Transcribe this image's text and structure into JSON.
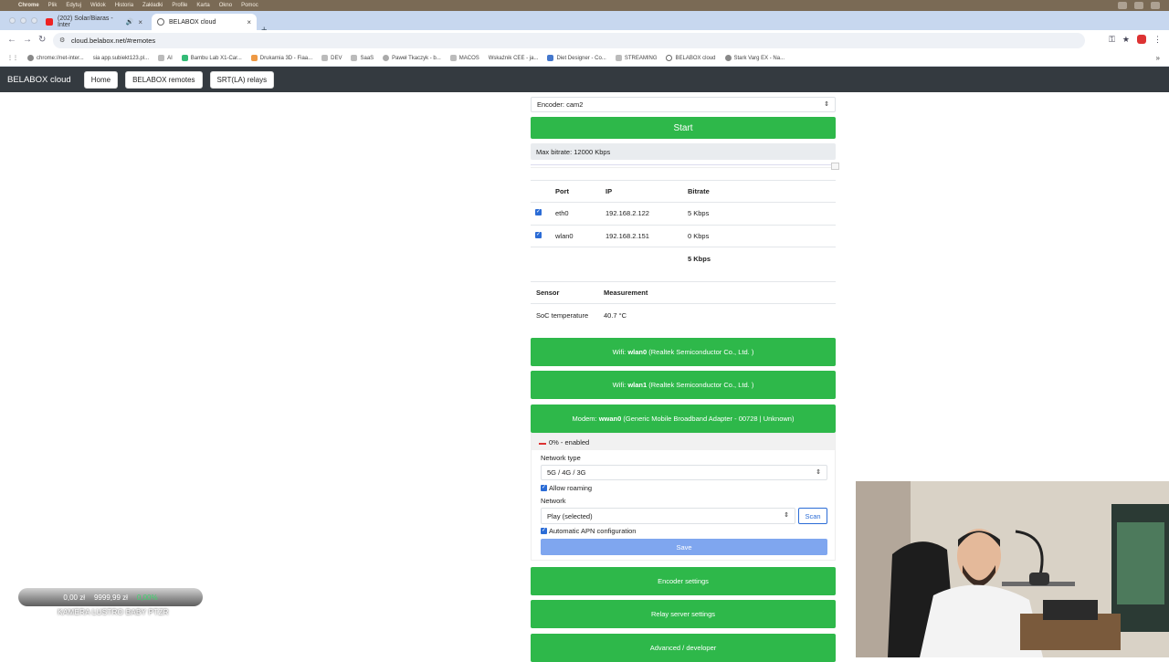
{
  "macos_menubar": {
    "app": "Chrome",
    "items": [
      "Plik",
      "Edytuj",
      "Widok",
      "Historia",
      "Zakładki",
      "Profile",
      "Karta",
      "Okno",
      "Pomoc"
    ]
  },
  "browser": {
    "tabs": [
      {
        "title": "(202) Solar/Biaras - Inter",
        "active": false
      },
      {
        "title": "BELABOX cloud",
        "active": true
      }
    ],
    "url": "cloud.belabox.net/#remotes",
    "bookmarks": [
      "chrome://net-inter...",
      "sia app.subiekt123.pl...",
      "AI",
      "Bambu Lab X1-Car...",
      "Drukarnia 3D - Fiaa...",
      "DEV",
      "SaaS",
      "Paweł Tkaczyk - b...",
      "MACOS",
      "Wskaźnik CEE - ja...",
      "Diet Designer - Co...",
      "STREAMING",
      "BELABOX cloud",
      "Stark Varg EX - Na..."
    ]
  },
  "app": {
    "brand": "BELABOX cloud",
    "nav": [
      "Home",
      "BELABOX remotes",
      "SRT(LA) relays"
    ]
  },
  "encoder": {
    "select_value": "Encoder: cam2",
    "start_label": "Start",
    "max_bitrate": "Max bitrate: 12000 Kbps",
    "max_bitrate_value": 12000
  },
  "network_table": {
    "headers": [
      "Port",
      "IP",
      "Bitrate"
    ],
    "rows": [
      {
        "checked": true,
        "port": "eth0",
        "ip": "192.168.2.122",
        "bitrate": "5 Kbps"
      },
      {
        "checked": true,
        "port": "wlan0",
        "ip": "192.168.2.151",
        "bitrate": "0 Kbps"
      }
    ],
    "total": "5 Kbps"
  },
  "sensor_table": {
    "headers": [
      "Sensor",
      "Measurement"
    ],
    "rows": [
      {
        "sensor": "SoC temperature",
        "value": "40.7 °C"
      }
    ]
  },
  "wifi": [
    {
      "prefix": "Wifi: ",
      "iface": "wlan0",
      "desc": " (Realtek Semiconductor Co., Ltd. )"
    },
    {
      "prefix": "Wifi: ",
      "iface": "wlan1",
      "desc": " (Realtek Semiconductor Co., Ltd. )"
    }
  ],
  "modem": {
    "prefix": "Modem: ",
    "iface": "wwan0",
    "desc": " (Generic Mobile Broadband Adapter - 00728 | Unknown)",
    "status": "0% - enabled",
    "network_type_label": "Network type",
    "network_type_value": "5G / 4G / 3G",
    "allow_roaming_label": "Allow roaming",
    "allow_roaming": true,
    "network_label": "Network",
    "network_value": "Play (selected)",
    "scan_label": "Scan",
    "auto_apn_label": "Automatic APN configuration",
    "auto_apn": true,
    "save_label": "Save"
  },
  "sections": [
    "Encoder settings",
    "Relay server settings",
    "Advanced / developer"
  ],
  "overlay": {
    "donation_left": "0,00 zł",
    "donation_mid": "9999,99 zł",
    "donation_right": "0,00%",
    "caption": "KAMERA LUSTRO BABY PTZR"
  },
  "colors": {
    "green": "#2eb84a",
    "navbar": "#343a40",
    "accent_blue": "#2b6cd6",
    "save_blue": "#7fa6ef"
  }
}
